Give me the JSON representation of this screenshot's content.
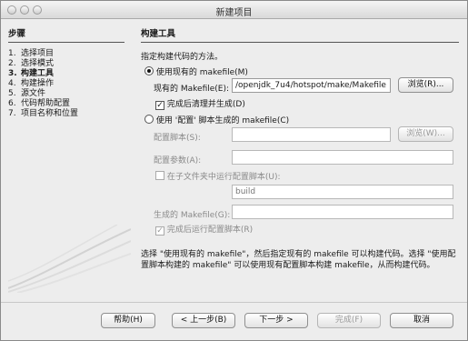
{
  "window": {
    "title": "新建项目"
  },
  "steps": {
    "heading": "步骤",
    "items": [
      {
        "num": "1.",
        "label": "选择项目"
      },
      {
        "num": "2.",
        "label": "选择模式"
      },
      {
        "num": "3.",
        "label": "构建工具"
      },
      {
        "num": "4.",
        "label": "构建操作"
      },
      {
        "num": "5.",
        "label": "源文件"
      },
      {
        "num": "6.",
        "label": "代码帮助配置"
      },
      {
        "num": "7.",
        "label": "项目名称和位置"
      }
    ]
  },
  "panel": {
    "heading": "构建工具",
    "intro": "指定构建代码的方法。",
    "use_existing": {
      "label": "使用现有的 makefile(M)",
      "makefile_label": "现有的 Makefile(E):",
      "makefile_value": "/openjdk_7u4/hotspot/make/Makefile",
      "browse_label": "浏览(R)...",
      "clean_label": "完成后清理并生成(D)"
    },
    "use_configure": {
      "label": "使用 '配置' 脚本生成的 makefile(C)",
      "script_label": "配置脚本(S):",
      "script_value": "",
      "browse_label": "浏览(W)...",
      "args_label": "配置参数(A):",
      "args_value": "",
      "subfolder_label": "在子文件夹中运行配置脚本(U):",
      "subfolder_value": "build",
      "generated_label": "生成的 Makefile(G):",
      "generated_value": "",
      "run_label": "完成后运行配置脚本(R)"
    },
    "description": "选择 \"使用现有的 makefile\"，然后指定现有的 makefile 可以构建代码。选择 \"使用配置脚本构建的 makefile\" 可以使用现有配置脚本构建 makefile，从而构建代码。"
  },
  "buttons": {
    "help": "帮助(H)",
    "back": "< 上一步(B)",
    "next": "下一步 >",
    "finish": "完成(F)",
    "cancel": "取消"
  }
}
